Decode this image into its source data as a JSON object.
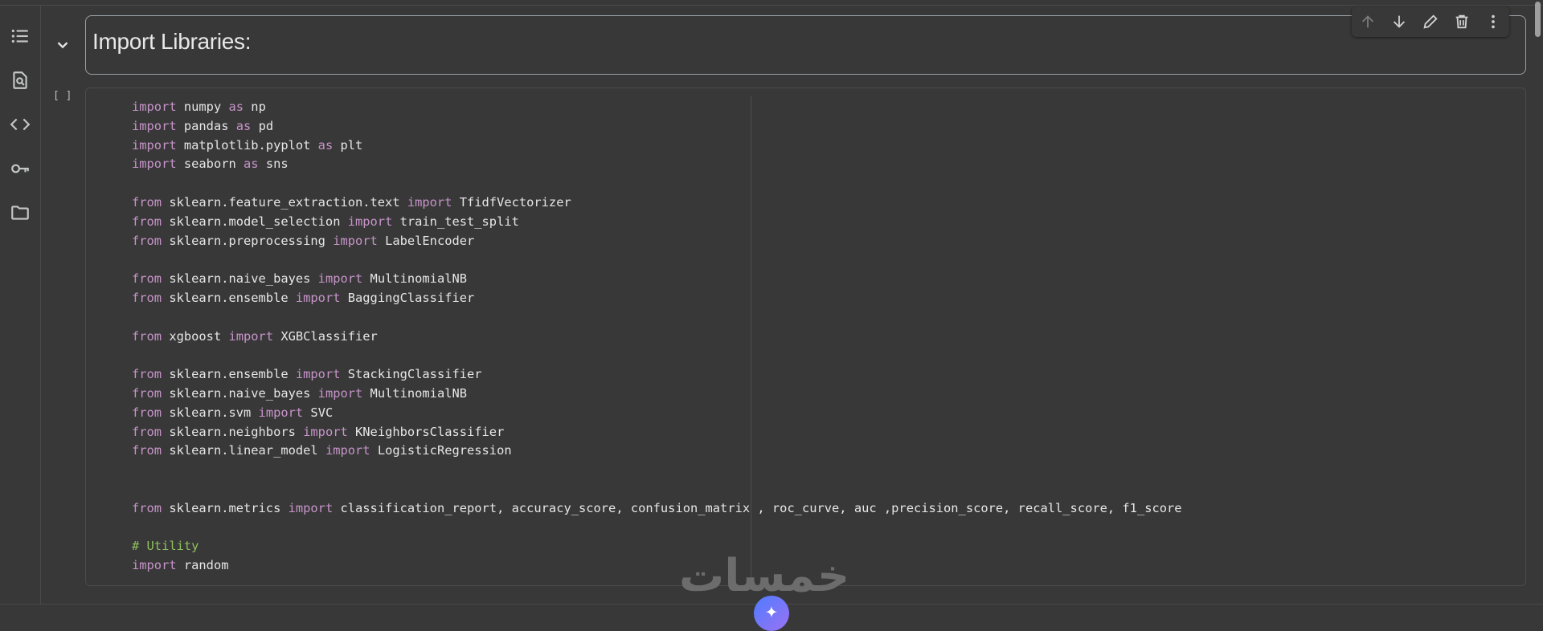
{
  "sidebar": {
    "items": [
      {
        "icon": "table-of-contents-icon"
      },
      {
        "icon": "find-replace-icon"
      },
      {
        "icon": "code-snippets-icon"
      },
      {
        "icon": "secrets-key-icon"
      },
      {
        "icon": "files-folder-icon"
      }
    ]
  },
  "text_cell": {
    "heading": "Import Libraries:"
  },
  "cell_toolbar": {
    "icons": [
      "arrow-up-icon",
      "arrow-down-icon",
      "edit-pencil-icon",
      "delete-trash-icon",
      "more-vert-icon"
    ]
  },
  "code_cell": {
    "execution_count": "[ ]",
    "lines": [
      [
        {
          "t": "import",
          "k": "kw"
        },
        {
          "t": " numpy "
        },
        {
          "t": "as",
          "k": "kw"
        },
        {
          "t": " np"
        }
      ],
      [
        {
          "t": "import",
          "k": "kw"
        },
        {
          "t": " pandas "
        },
        {
          "t": "as",
          "k": "kw"
        },
        {
          "t": " pd"
        }
      ],
      [
        {
          "t": "import",
          "k": "kw"
        },
        {
          "t": " matplotlib.pyplot "
        },
        {
          "t": "as",
          "k": "kw"
        },
        {
          "t": " plt"
        }
      ],
      [
        {
          "t": "import",
          "k": "kw"
        },
        {
          "t": " seaborn "
        },
        {
          "t": "as",
          "k": "kw"
        },
        {
          "t": " sns"
        }
      ],
      [],
      [
        {
          "t": "from",
          "k": "kw"
        },
        {
          "t": " sklearn.feature_extraction.text "
        },
        {
          "t": "import",
          "k": "kw"
        },
        {
          "t": " TfidfVectorizer"
        }
      ],
      [
        {
          "t": "from",
          "k": "kw"
        },
        {
          "t": " sklearn.model_selection "
        },
        {
          "t": "import",
          "k": "kw"
        },
        {
          "t": " train_test_split"
        }
      ],
      [
        {
          "t": "from",
          "k": "kw"
        },
        {
          "t": " sklearn.preprocessing "
        },
        {
          "t": "import",
          "k": "kw"
        },
        {
          "t": " LabelEncoder"
        }
      ],
      [],
      [
        {
          "t": "from",
          "k": "kw"
        },
        {
          "t": " sklearn.naive_bayes "
        },
        {
          "t": "import",
          "k": "kw"
        },
        {
          "t": " MultinomialNB"
        }
      ],
      [
        {
          "t": "from",
          "k": "kw"
        },
        {
          "t": " sklearn.ensemble "
        },
        {
          "t": "import",
          "k": "kw"
        },
        {
          "t": " BaggingClassifier"
        }
      ],
      [],
      [
        {
          "t": "from",
          "k": "kw"
        },
        {
          "t": " xgboost "
        },
        {
          "t": "import",
          "k": "kw"
        },
        {
          "t": " XGBClassifier"
        }
      ],
      [],
      [
        {
          "t": "from",
          "k": "kw"
        },
        {
          "t": " sklearn.ensemble "
        },
        {
          "t": "import",
          "k": "kw"
        },
        {
          "t": " StackingClassifier"
        }
      ],
      [
        {
          "t": "from",
          "k": "kw"
        },
        {
          "t": " sklearn.naive_bayes "
        },
        {
          "t": "import",
          "k": "kw"
        },
        {
          "t": " MultinomialNB"
        }
      ],
      [
        {
          "t": "from",
          "k": "kw"
        },
        {
          "t": " sklearn.svm "
        },
        {
          "t": "import",
          "k": "kw"
        },
        {
          "t": " SVC"
        }
      ],
      [
        {
          "t": "from",
          "k": "kw"
        },
        {
          "t": " sklearn.neighbors "
        },
        {
          "t": "import",
          "k": "kw"
        },
        {
          "t": " KNeighborsClassifier"
        }
      ],
      [
        {
          "t": "from",
          "k": "kw"
        },
        {
          "t": " sklearn.linear_model "
        },
        {
          "t": "import",
          "k": "kw"
        },
        {
          "t": " LogisticRegression"
        }
      ],
      [],
      [],
      [
        {
          "t": "from",
          "k": "kw"
        },
        {
          "t": " sklearn.metrics "
        },
        {
          "t": "import",
          "k": "kw"
        },
        {
          "t": " classification_report, accuracy_score, confusion_matrix , roc_curve, auc ,precision_score, recall_score, f1_score"
        }
      ],
      [],
      [
        {
          "t": "# Utility",
          "k": "cm"
        }
      ],
      [
        {
          "t": "import",
          "k": "kw"
        },
        {
          "t": " random"
        }
      ]
    ]
  },
  "watermark": {
    "text": "خمسات"
  },
  "colors": {
    "background": "#383838",
    "keyword": "#c794c9",
    "comment": "#8fbf5f",
    "text": "#e6e6e6"
  }
}
